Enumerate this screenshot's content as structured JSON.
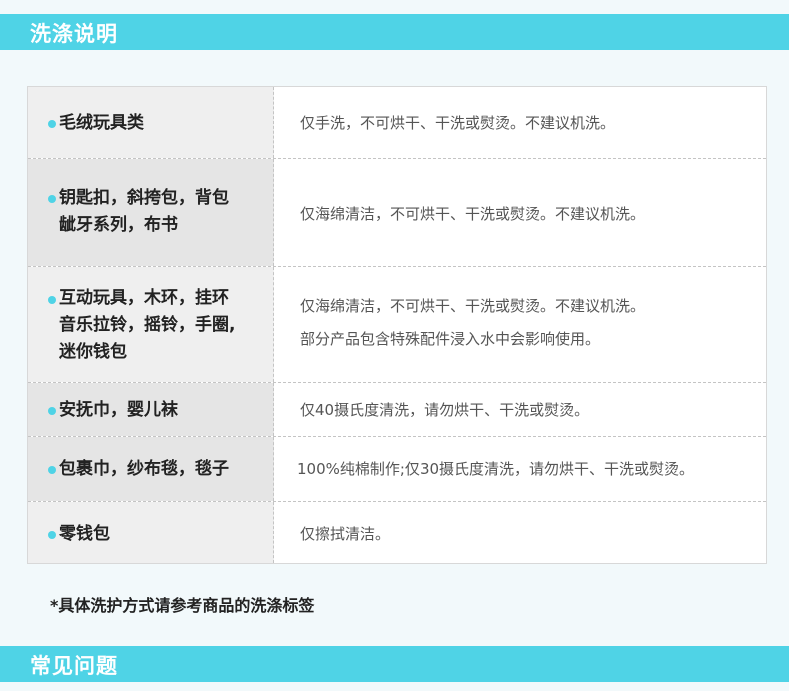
{
  "section_washing": {
    "title": "洗涤说明"
  },
  "care_table": {
    "rows": [
      {
        "category_lines": [
          "毛绒玩具类"
        ],
        "instructions": [
          "仅手洗，不可烘干、干洗或熨烫。不建议机洗。"
        ]
      },
      {
        "category_lines": [
          "钥匙扣，斜挎包，背包",
          "龇牙系列，布书"
        ],
        "instructions": [
          "仅海绵清洁，不可烘干、干洗或熨烫。不建议机洗。"
        ]
      },
      {
        "category_lines": [
          "互动玩具，木环，挂环",
          "音乐拉铃，摇铃，手圈,",
          "迷你钱包"
        ],
        "instructions": [
          "仅海绵清洁，不可烘干、干洗或熨烫。不建议机洗。",
          "部分产品包含特殊配件浸入水中会影响使用。"
        ]
      },
      {
        "category_lines": [
          "安抚巾，婴儿袜"
        ],
        "instructions": [
          "仅40摄氏度清洗，请勿烘干、干洗或熨烫。"
        ]
      },
      {
        "category_lines": [
          "包裹巾，纱布毯，毯子"
        ],
        "instructions": [
          "100%纯棉制作;仅30摄氏度清洗，请勿烘干、干洗或熨烫。"
        ]
      },
      {
        "category_lines": [
          "零钱包"
        ],
        "instructions": [
          "仅擦拭清洁。"
        ]
      }
    ]
  },
  "footnote": "*具体洗护方式请参考商品的洗涤标签",
  "section_faq": {
    "title": "常见问题"
  },
  "colors": {
    "accent": "#4fd3e6",
    "left_cell_bg": "#efefef",
    "left_cell_alt_bg": "#e5e5e5"
  }
}
